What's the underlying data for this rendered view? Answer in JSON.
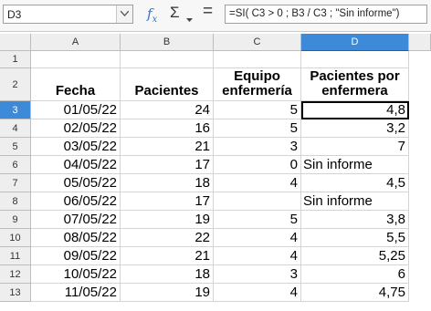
{
  "name_box": {
    "value": "D3"
  },
  "formula_bar": {
    "fx_label": "f",
    "fx_sub": "x",
    "sum_label": "Σ",
    "equals_label": "=",
    "formula": "=SI( C3 > 0 ; B3 / C3 ; \"Sin informe\")"
  },
  "columns": [
    "A",
    "B",
    "C",
    "D"
  ],
  "rows": [
    "1",
    "2",
    "3",
    "4",
    "5",
    "6",
    "7",
    "8",
    "9",
    "10",
    "11",
    "12",
    "13"
  ],
  "headers": {
    "fecha": "Fecha",
    "pacientes": "Pacientes",
    "equipo": "Equipo enfermería",
    "ratio": "Pacientes por enfermera"
  },
  "data": [
    {
      "fecha": "01/05/22",
      "pacientes": "24",
      "equipo": "5",
      "ratio": "4,8"
    },
    {
      "fecha": "02/05/22",
      "pacientes": "16",
      "equipo": "5",
      "ratio": "3,2"
    },
    {
      "fecha": "03/05/22",
      "pacientes": "21",
      "equipo": "3",
      "ratio": "7"
    },
    {
      "fecha": "04/05/22",
      "pacientes": "17",
      "equipo": "0",
      "ratio": "Sin informe"
    },
    {
      "fecha": "05/05/22",
      "pacientes": "18",
      "equipo": "4",
      "ratio": "4,5"
    },
    {
      "fecha": "06/05/22",
      "pacientes": "17",
      "equipo": "",
      "ratio": "Sin informe"
    },
    {
      "fecha": "07/05/22",
      "pacientes": "19",
      "equipo": "5",
      "ratio": "3,8"
    },
    {
      "fecha": "08/05/22",
      "pacientes": "22",
      "equipo": "4",
      "ratio": "5,5"
    },
    {
      "fecha": "09/05/22",
      "pacientes": "21",
      "equipo": "4",
      "ratio": "5,25"
    },
    {
      "fecha": "10/05/22",
      "pacientes": "18",
      "equipo": "3",
      "ratio": "6"
    },
    {
      "fecha": "11/05/22",
      "pacientes": "19",
      "equipo": "4",
      "ratio": "4,75"
    }
  ],
  "colors": {
    "selection": "#3c8ad8",
    "fx_icon": "#3574c4"
  },
  "icons": [
    "chevron-down-icon",
    "function-wizard-icon",
    "sum-icon",
    "equals-icon"
  ]
}
